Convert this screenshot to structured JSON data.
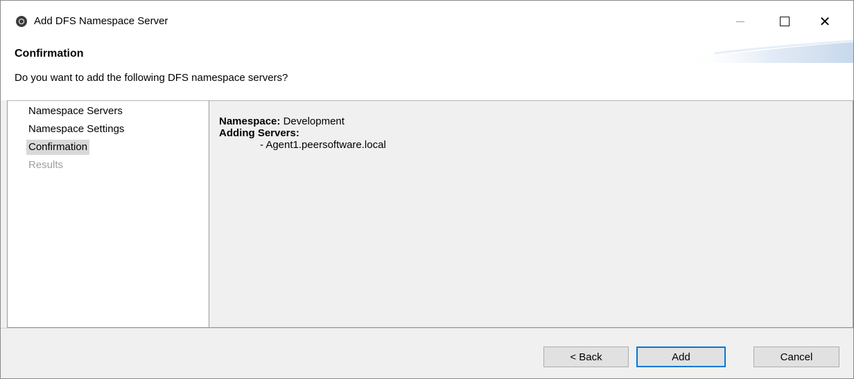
{
  "window": {
    "title": "Add DFS Namespace Server",
    "icons": {
      "app": "peer-software-icon",
      "minimize": "minimize-icon",
      "maximize": "maximize-icon",
      "close": "close-icon"
    }
  },
  "header": {
    "title": "Confirmation",
    "description": "Do you want to add the following DFS namespace servers?"
  },
  "steps": [
    {
      "label": "Namespace Servers",
      "state": "completed"
    },
    {
      "label": "Namespace Settings",
      "state": "completed"
    },
    {
      "label": "Confirmation",
      "state": "current"
    },
    {
      "label": "Results",
      "state": "disabled"
    }
  ],
  "summary": {
    "namespace_label": "Namespace:",
    "namespace_value": "Development",
    "servers_label": "Adding Servers:",
    "servers": [
      "- Agent1.peersoftware.local"
    ]
  },
  "buttons": {
    "back": "< Back",
    "add": "Add",
    "cancel": "Cancel"
  },
  "colors": {
    "accent": "#0078d7",
    "selected_step": "#d9d9d9",
    "disabled_text": "#a0a0a0",
    "pane_background": "#f0f0f0"
  }
}
